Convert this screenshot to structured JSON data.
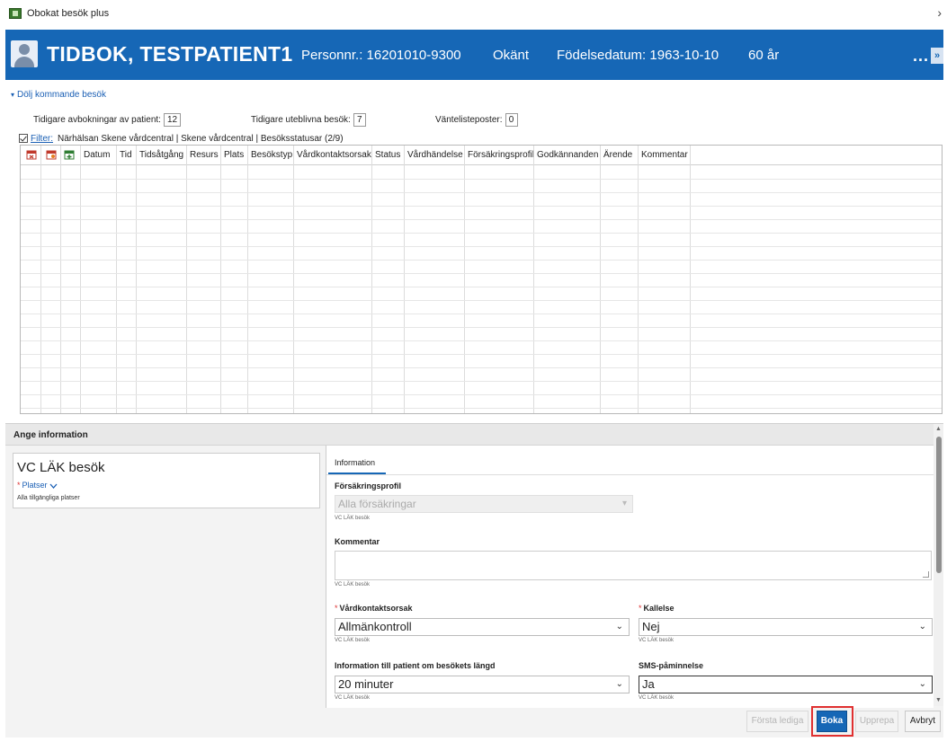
{
  "window": {
    "title": "Obokat besök plus",
    "close_glyph": "›"
  },
  "header": {
    "patient_name": "TIDBOK, TESTPATIENT1",
    "personnr": "Personnr.: 16201010-9300",
    "gender": "Okänt",
    "birthdate": "Födelsedatum: 1963-10-10",
    "age": "60 år",
    "more": "...",
    "expand": "»",
    "color": "#1667b6"
  },
  "upcoming": {
    "toggle_label": "Dölj kommande besök",
    "toggle_icon": "▾",
    "prev_cancellations_label": "Tidigare avbokningar av patient:",
    "prev_cancellations": "12",
    "prev_noshows_label": "Tidigare uteblivna besök:",
    "prev_noshows": "7",
    "waitlist_label": "Väntelisteposter:",
    "waitlist": "0",
    "filter_link": "Filter:",
    "filter_text": "Närhälsan Skene vårdcentral | Skene vårdcentral | Besöksstatusar (2/9)",
    "columns": [
      "Datum",
      "Tid",
      "Tidsåtgång",
      "Resurs",
      "Plats",
      "Besökstyp",
      "Vårdkontaktsorsak",
      "Status",
      "Vårdhändelse",
      "Försäkringsprofil",
      "Godkännanden",
      "Ärende",
      "Kommentar"
    ]
  },
  "panel": {
    "title": "Ange information",
    "visit_type": "VC LÄK besök",
    "places_label": "Platser",
    "places_value": "Alla tillgängliga platser",
    "tab": "Information",
    "insurance_label": "Försäkringsprofil",
    "insurance_value": "Alla försäkringar",
    "insurance_sub": "VC LÄK besök",
    "comment_label": "Kommentar",
    "comment_sub": "VC LÄK besök",
    "reason_label": "Vårdkontaktsorsak",
    "reason_value": "Allmänkontroll",
    "reason_sub": "VC LÄK besök",
    "call_label": "Kallelse",
    "call_value": "Nej",
    "call_sub": "VC LÄK besök",
    "duration_label": "Information till patient om besökets längd",
    "duration_value": "20 minuter",
    "duration_sub": "VC LÄK besök",
    "sms_label": "SMS-påminnelse",
    "sms_value": "Ja",
    "sms_sub": "VC LÄK besök"
  },
  "buttons": {
    "first_free": "Första lediga",
    "book": "Boka",
    "repeat": "Upprepa",
    "cancel": "Avbryt"
  }
}
